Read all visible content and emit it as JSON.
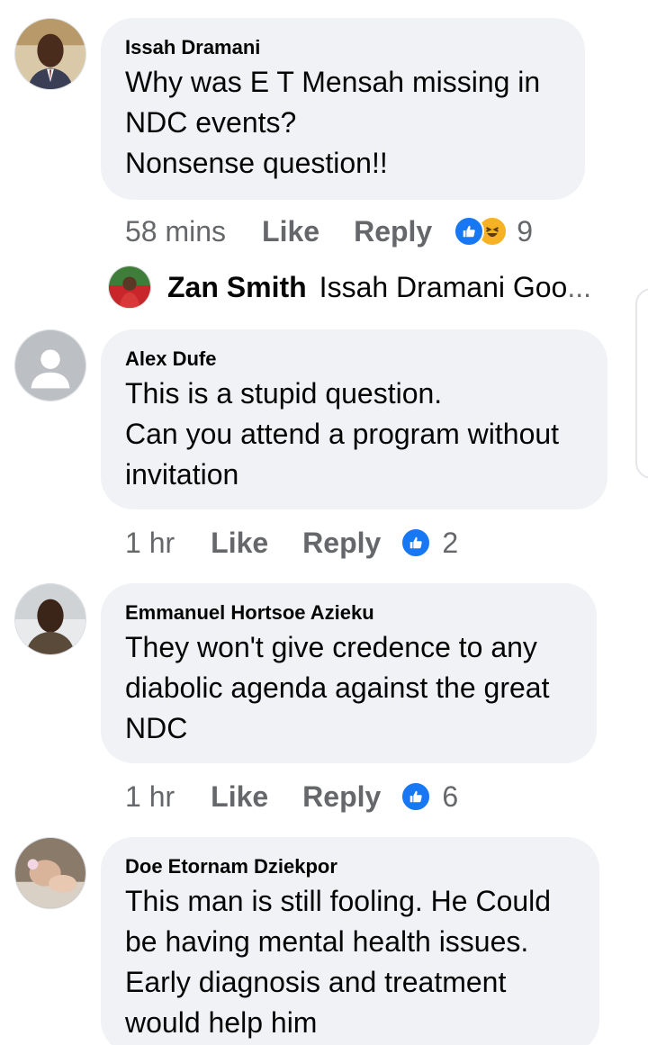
{
  "comments": [
    {
      "author": "Issah Dramani",
      "lines": [
        "Why was E T Mensah missing in",
        "NDC events?",
        "Nonsense question!!"
      ],
      "time": "58 mins",
      "like_label": "Like",
      "reply_label": "Reply",
      "reaction_count": "9",
      "reactions": [
        "like-icon",
        "haha-icon"
      ]
    },
    {
      "author": "Alex Dufe",
      "lines": [
        "This is a stupid question.",
        "Can you attend a program without",
        "invitation"
      ],
      "time": "1 hr",
      "like_label": "Like",
      "reply_label": "Reply",
      "reaction_count": "2",
      "reactions": [
        "like-icon"
      ]
    },
    {
      "author": "Emmanuel Hortsoe Azieku",
      "lines": [
        "They won't give credence to any",
        "diabolic agenda against the great",
        "NDC"
      ],
      "time": "1 hr",
      "like_label": "Like",
      "reply_label": "Reply",
      "reaction_count": "6",
      "reactions": [
        "like-icon"
      ]
    },
    {
      "author": "Doe Etornam Dziekpor",
      "lines": [
        "This man is still fooling. He Could",
        "be having mental health issues.",
        "Early diagnosis and treatment",
        "would help him"
      ]
    }
  ],
  "reply_preview": {
    "author": "Zan Smith",
    "text": "Issah Dramani Goo",
    "ellipsis": "..."
  },
  "colors": {
    "bubble": "#f0f2f5",
    "meta_text": "#65676b",
    "like_blue": "#1877f2",
    "haha_yellow": "#f7b125"
  }
}
